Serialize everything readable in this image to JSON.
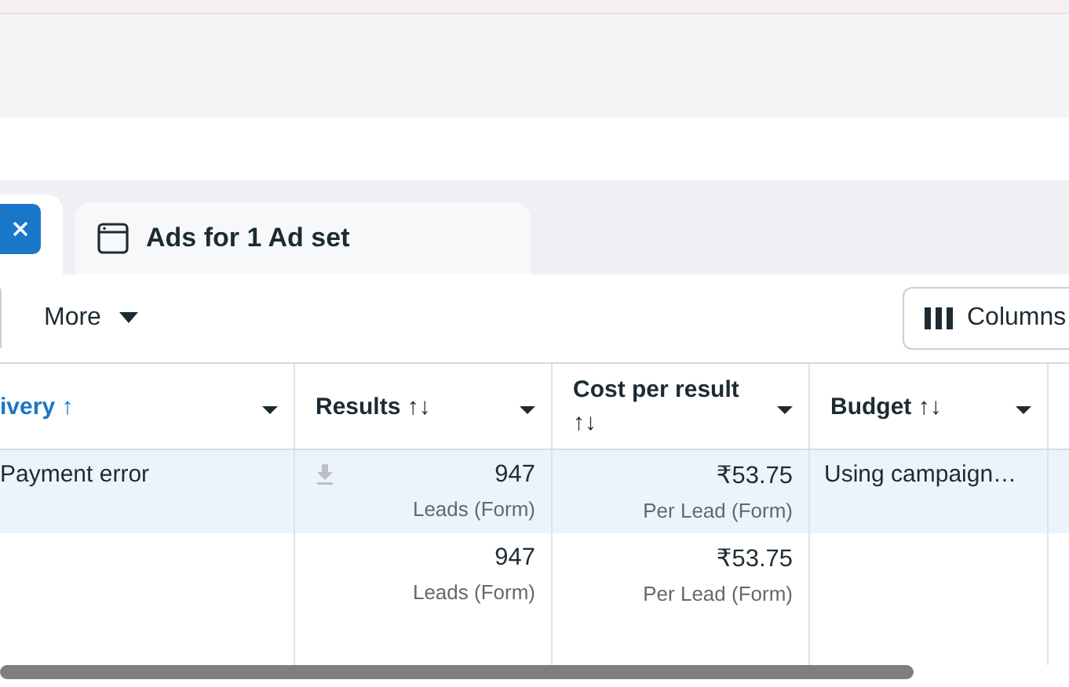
{
  "tabs": [
    {
      "kind": "close",
      "selected": true
    },
    {
      "kind": "label",
      "label": "Ads for 1 Ad set",
      "selected": false
    }
  ],
  "toolbar": {
    "more": "More",
    "columns": "Columns"
  },
  "table": {
    "columns": [
      {
        "label": "ivery",
        "sort": "↑",
        "active": true
      },
      {
        "label": "Results",
        "sort": "↑↓",
        "active": false
      },
      {
        "label": "Cost per result",
        "sort": "↑↓",
        "active": false
      },
      {
        "label": "Budget",
        "sort": "↑↓",
        "active": false
      }
    ],
    "rows": [
      {
        "selected": true,
        "delivery": "Payment error",
        "download": true,
        "results": "947",
        "results_sub": "Leads (Form)",
        "cost": "₹53.75",
        "cost_sub": "Per Lead (Form)",
        "budget": "Using campaign…"
      },
      {
        "selected": false,
        "delivery": "",
        "download": false,
        "results": "947",
        "results_sub": "Leads (Form)",
        "cost": "₹53.75",
        "cost_sub": "Per Lead (Form)",
        "budget": ""
      }
    ]
  }
}
